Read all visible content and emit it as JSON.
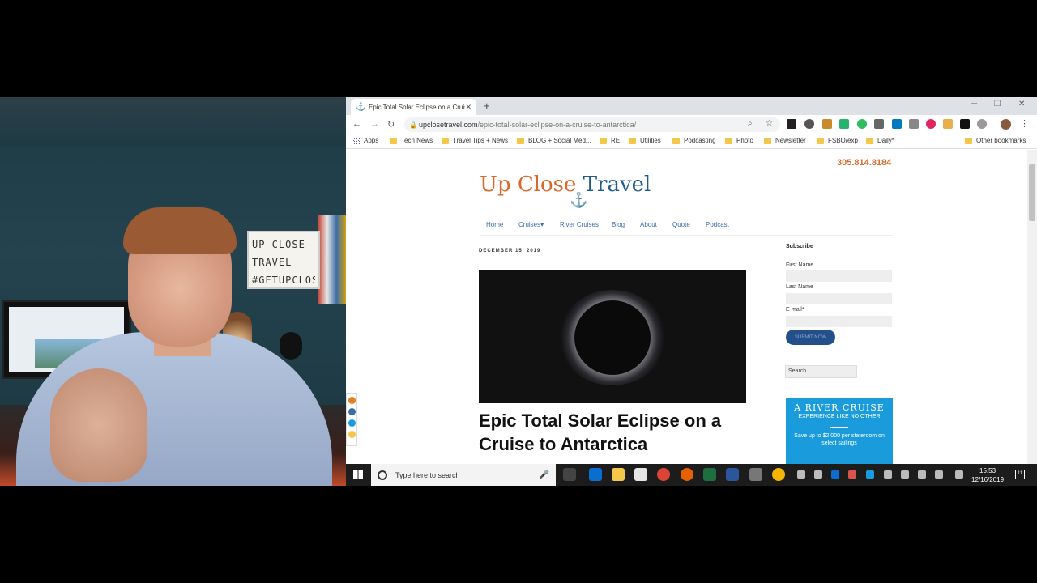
{
  "browser": {
    "tab": {
      "title": "Epic Total Solar Eclipse on a Cruise",
      "icon": "anchor-icon"
    },
    "address": {
      "domain": "upclosetravel.com",
      "path": "/epic-total-solar-eclipse-on-a-cruise-to-antarctica/"
    },
    "bookmarks": [
      {
        "label": "Apps",
        "icon": "apps-icon"
      },
      {
        "label": "Tech News"
      },
      {
        "label": "Travel Tips + News"
      },
      {
        "label": "BLOG + Social Med..."
      },
      {
        "label": "RE"
      },
      {
        "label": "Utilities"
      },
      {
        "label": "Podcasting"
      },
      {
        "label": "Photo"
      },
      {
        "label": "Newsletter"
      },
      {
        "label": "FSBO/exp"
      },
      {
        "label": "Daily*"
      },
      {
        "label": "Other bookmarks"
      }
    ]
  },
  "site": {
    "phone": "305.814.8184",
    "logo": {
      "part1": "Up Close ",
      "part2": "Travel"
    },
    "nav": [
      "Home",
      "Cruises",
      "River Cruises",
      "Blog",
      "About",
      "Quote",
      "Podcast"
    ],
    "cruises_caret": "▾"
  },
  "post": {
    "date": "DECEMBER 15, 2019",
    "title": "Epic Total Solar Eclipse on a Cruise to Antarctica"
  },
  "sidebar": {
    "subscribe_title": "Subscribe",
    "first_name_label": "First Name",
    "last_name_label": "Last Name",
    "email_label": "E-mail*",
    "submit_label": "SUBMIT NOW",
    "search_placeholder": "Search...",
    "ad": {
      "headline": "A RIVER CRUISE",
      "subhead": "EXPERIENCE LIKE NO OTHER",
      "copy": "Save up to $2,000 per stateroom on select sailings"
    }
  },
  "webcam": {
    "sign_lines": [
      "UP CLOSE",
      "TRAVEL",
      "#GETUPCLOSE"
    ]
  },
  "taskbar": {
    "search_placeholder": "Type here to search",
    "time": "15:53",
    "date": "12/16/2019",
    "notification_count": "11"
  },
  "colors": {
    "brand_orange": "#d9692b",
    "brand_blue": "#1f5c8b",
    "link_blue": "#3a6ea5",
    "ad_blue": "#1a9bdc"
  }
}
